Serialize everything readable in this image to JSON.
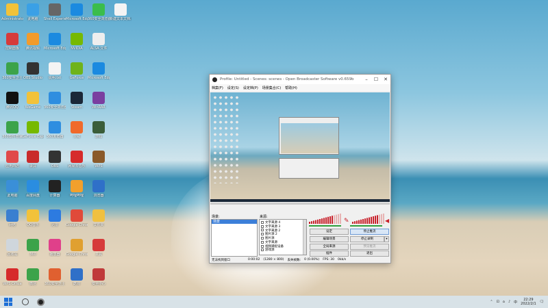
{
  "desktop": {
    "icons": [
      {
        "label": "Administrator",
        "color": "#f2c23a"
      },
      {
        "label": "此电脑",
        "color": "#3aa0e6"
      },
      {
        "label": "Shell Experience",
        "color": "#666"
      },
      {
        "label": "Microsoft Edge",
        "color": "#1b8ae0"
      },
      {
        "label": "360安全浏览器",
        "color": "#3bbd4c"
      },
      {
        "label": "新建文本文档.txt",
        "color": "#f4f4f4"
      },
      {
        "label": "控制面板",
        "color": "#d63b3b"
      },
      {
        "label": "腾讯视频",
        "color": "#f29b2c"
      },
      {
        "label": "Microsoft Edge",
        "color": "#1b8ae0"
      },
      {
        "label": "NVIDIA",
        "color": "#76b900"
      },
      {
        "label": "ALSA 文件",
        "color": "#eee"
      },
      {
        "label": "360安全卫士",
        "color": "#3ca34a"
      },
      {
        "label": "OBS Studio",
        "color": "#333"
      },
      {
        "label": "说明.txt",
        "color": "#f4f4f4"
      },
      {
        "label": "GeForce",
        "color": "#6fb31a"
      },
      {
        "label": "Microsoft Edge",
        "color": "#1b8ae0"
      },
      {
        "label": "腾讯QQ",
        "color": "#111"
      },
      {
        "label": "WeGame",
        "color": "#f2c23a"
      },
      {
        "label": "360安全浏览器",
        "color": "#2f8ee0"
      },
      {
        "label": "Steam",
        "color": "#1b2838"
      },
      {
        "label": "WinRAR",
        "color": "#7a3fa0"
      },
      {
        "label": "360软件管家",
        "color": "#3ca34a"
      },
      {
        "label": "GeForce Experience",
        "color": "#76b900"
      },
      {
        "label": "360浏览器",
        "color": "#2f8ee0"
      },
      {
        "label": "火绒",
        "color": "#f06a2b"
      },
      {
        "label": "游戏",
        "color": "#3a5d3a"
      },
      {
        "label": "应用商店",
        "color": "#e04a4a"
      },
      {
        "label": "录屏",
        "color": "#c92b2b"
      },
      {
        "label": "OBS",
        "color": "#333"
      },
      {
        "label": "网易云音乐",
        "color": "#d62b2b"
      },
      {
        "label": "WPS",
        "color": "#8a5a2a"
      },
      {
        "label": "此电脑",
        "color": "#3a8fd8"
      },
      {
        "label": "百度网盘",
        "color": "#2a8de0"
      },
      {
        "label": "计算器",
        "color": "#222"
      },
      {
        "label": "哔哩哔哩",
        "color": "#f2a02c"
      },
      {
        "label": "浏览器",
        "color": "#2f70c8"
      },
      {
        "label": "网络",
        "color": "#3a7fd0"
      },
      {
        "label": "QQ音乐",
        "color": "#f2c23a"
      },
      {
        "label": "迅雷",
        "color": "#2d7be0"
      },
      {
        "label": "Google Chrome",
        "color": "#e04a3a"
      },
      {
        "label": "文件夹",
        "color": "#f0c040"
      },
      {
        "label": "回收站",
        "color": "#cfd6dc"
      },
      {
        "label": "360",
        "color": "#3ca34a"
      },
      {
        "label": "播放器",
        "color": "#e0408a"
      },
      {
        "label": "Google Chrome",
        "color": "#e0a030"
      },
      {
        "label": "工具",
        "color": "#d63b3b"
      },
      {
        "label": "WPS Office",
        "color": "#d62b2b"
      },
      {
        "label": "微信",
        "color": "#3ca34a"
      },
      {
        "label": "360安全卫士",
        "color": "#e06030"
      },
      {
        "label": "酷狗",
        "color": "#2f70c8"
      },
      {
        "label": "安全中心",
        "color": "#c03a3a"
      }
    ]
  },
  "obs": {
    "title": "Profile: Untitled - Scenes: scenes - Open Broadcaster Software v0.659b",
    "menu": [
      "档案(F)",
      "设定(S)",
      "设定档(P)",
      "场景集合(C)",
      "帮助(H)"
    ],
    "scenes_label": "场景:",
    "sources_label": "来源:",
    "scenes": [
      "场景"
    ],
    "sources": [
      "文字来源 4",
      "文字来源 3",
      "文字来源 2",
      "图片源 2",
      "图片源",
      "文字来源",
      "视频捕捉设备",
      "游戏源"
    ],
    "buttons": {
      "settings": "设定",
      "edit_scene": "编辑场景",
      "global_sources": "全局来源",
      "plugins": "插件",
      "stop_preview": "停止推流",
      "stop_recording": "停止录制",
      "start_stream": "预览推流",
      "exit": "退出"
    },
    "status": {
      "mode": "无法找到窗口",
      "time": "0:00:02",
      "res": "(1280 × 800)",
      "dropped": "丢失帧数:",
      "dropped_val": "0 (0.00%)",
      "fps": "FPS: 30",
      "rate": "0kb/s"
    },
    "audio_level_mic": 0.78,
    "audio_level_desktop": 0.82
  },
  "taskbar": {
    "time": "22:29",
    "date": "2022/2/1",
    "tray": [
      "⌃",
      "⊡",
      "⌂",
      "♪",
      "中"
    ]
  }
}
